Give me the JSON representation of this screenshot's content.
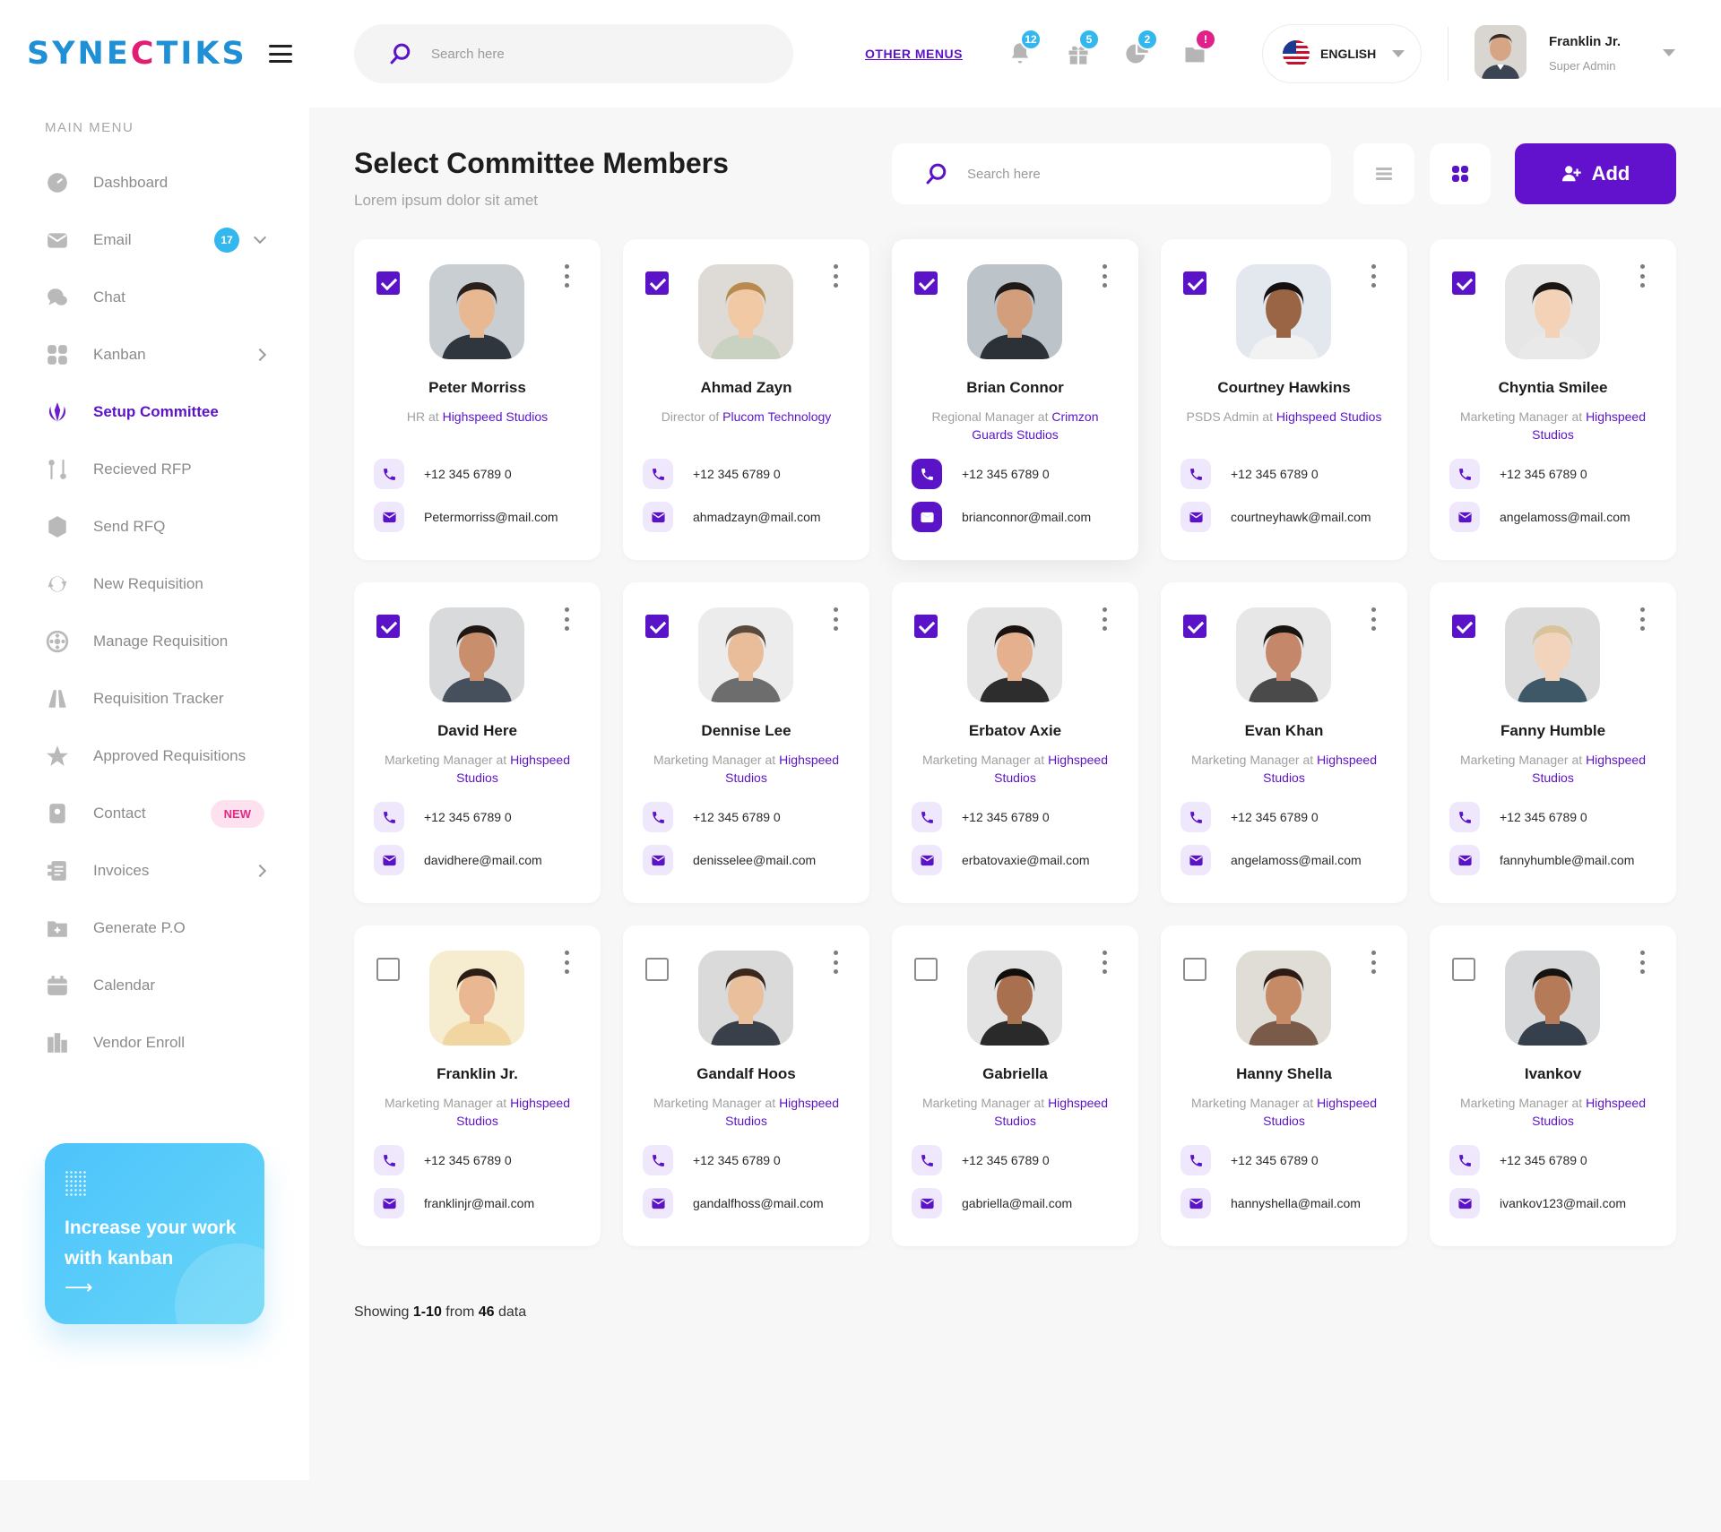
{
  "brand": {
    "logo_pre": "SYNE",
    "logo_mark": "C",
    "logo_post": "TIKS"
  },
  "sidebar": {
    "title": "MAIN MENU",
    "items": [
      {
        "label": "Dashboard",
        "icon": "dashboard-icon"
      },
      {
        "label": "Email",
        "icon": "email-icon",
        "count": "17"
      },
      {
        "label": "Chat",
        "icon": "chat-icon"
      },
      {
        "label": "Kanban",
        "icon": "kanban-icon"
      },
      {
        "label": "Setup Committee",
        "icon": "committee-icon"
      },
      {
        "label": "Recieved RFP",
        "icon": "rfp-icon"
      },
      {
        "label": "Send RFQ",
        "icon": "rfq-icon"
      },
      {
        "label": "New Requisition",
        "icon": "refresh-icon"
      },
      {
        "label": "Manage Requisition",
        "icon": "manage-icon"
      },
      {
        "label": "Requisition Tracker",
        "icon": "road-icon"
      },
      {
        "label": "Approved Requisitions",
        "icon": "star-icon"
      },
      {
        "label": "Contact",
        "icon": "contact-icon",
        "badge": "NEW"
      },
      {
        "label": "Invoices",
        "icon": "invoice-icon"
      },
      {
        "label": "Generate P.O",
        "icon": "folder-plus-icon"
      },
      {
        "label": "Calendar",
        "icon": "calendar-icon"
      },
      {
        "label": "Vendor Enroll",
        "icon": "vendor-icon"
      }
    ],
    "promo": {
      "text": "Increase your work with kanban",
      "arrow": "⟶"
    }
  },
  "header": {
    "search_placeholder": "Search here",
    "other_menus": "OTHER MENUS",
    "notifications": [
      {
        "icon": "bell-icon",
        "count": "12"
      },
      {
        "icon": "gift-icon",
        "count": "5"
      },
      {
        "icon": "pie-chart-icon",
        "count": "2"
      },
      {
        "icon": "archive-icon",
        "count": "!"
      }
    ],
    "language": "ENGLISH",
    "user": {
      "name": "Franklin Jr.",
      "role": "Super Admin"
    }
  },
  "main": {
    "title": "Select Committee Members",
    "subtitle": "Lorem ipsum  dolor sit amet",
    "search_placeholder": "Search here",
    "add_label": "Add",
    "colors": {
      "accent": "#5b13c7",
      "accent_light": "#efe7fb",
      "brand_blue": "#1f8fd6",
      "brand_pink": "#e11d74"
    },
    "members": [
      {
        "name": "Peter Morriss",
        "role": "HR at ",
        "company": "Highspeed Studios",
        "phone": "+12 345 6789 0",
        "email": "Petermorriss@mail.com",
        "checked": true
      },
      {
        "name": "Ahmad Zayn",
        "role": "Director of ",
        "company": "Plucom Technology",
        "phone": "+12 345 6789 0",
        "email": "ahmadzayn@mail.com",
        "checked": true
      },
      {
        "name": "Brian Connor",
        "role": "Regional Manager  at ",
        "company": "Crimzon Guards Studios",
        "phone": "+12 345 6789 0",
        "email": "brianconnor@mail.com",
        "checked": true,
        "focused": true
      },
      {
        "name": "Courtney Hawkins",
        "role": "PSDS Admin at ",
        "company": "Highspeed Studios",
        "phone": "+12 345 6789 0",
        "email": "courtneyhawk@mail.com",
        "checked": true
      },
      {
        "name": "Chyntia Smilee",
        "role": "Marketing Manager at ",
        "company": "Highspeed Studios",
        "phone": "+12 345 6789 0",
        "email": "angelamoss@mail.com",
        "checked": true
      },
      {
        "name": "David Here",
        "role": "Marketing Manager at ",
        "company": "Highspeed Studios",
        "phone": "+12 345 6789 0",
        "email": "davidhere@mail.com",
        "checked": true
      },
      {
        "name": "Dennise Lee",
        "role": "Marketing Manager at ",
        "company": "Highspeed Studios",
        "phone": "+12 345 6789 0",
        "email": "denisselee@mail.com",
        "checked": true
      },
      {
        "name": "Erbatov Axie",
        "role": "Marketing Manager at ",
        "company": "Highspeed Studios",
        "phone": "+12 345 6789 0",
        "email": "erbatovaxie@mail.com",
        "checked": true
      },
      {
        "name": "Evan Khan",
        "role": "Marketing Manager at ",
        "company": "Highspeed Studios",
        "phone": "+12 345 6789 0",
        "email": "angelamoss@mail.com",
        "checked": true
      },
      {
        "name": "Fanny Humble",
        "role": "Marketing Manager at ",
        "company": "Highspeed Studios",
        "phone": "+12 345 6789 0",
        "email": "fannyhumble@mail.com",
        "checked": true
      },
      {
        "name": "Franklin Jr.",
        "role": "Marketing Manager at ",
        "company": "Highspeed Studios",
        "phone": "+12 345 6789 0",
        "email": "franklinjr@mail.com",
        "checked": false
      },
      {
        "name": "Gandalf Hoos",
        "role": "Marketing Manager at ",
        "company": "Highspeed Studios",
        "phone": "+12 345 6789 0",
        "email": "gandalfhoss@mail.com",
        "checked": false
      },
      {
        "name": "Gabriella",
        "role": "Marketing Manager at ",
        "company": "Highspeed Studios",
        "phone": "+12 345 6789 0",
        "email": "gabriella@mail.com",
        "checked": false
      },
      {
        "name": "Hanny Shella",
        "role": "Marketing Manager at ",
        "company": "Highspeed Studios",
        "phone": "+12 345 6789 0",
        "email": "hannyshella@mail.com",
        "checked": false
      },
      {
        "name": "Ivankov",
        "role": "Marketing Manager at ",
        "company": "Highspeed Studios",
        "phone": "+12 345 6789 0",
        "email": "ivankov123@mail.com",
        "checked": false
      }
    ],
    "showing": {
      "prefix": "Showing ",
      "range": "1-10",
      "mid": " from ",
      "total": "46",
      "suffix": " data"
    }
  }
}
